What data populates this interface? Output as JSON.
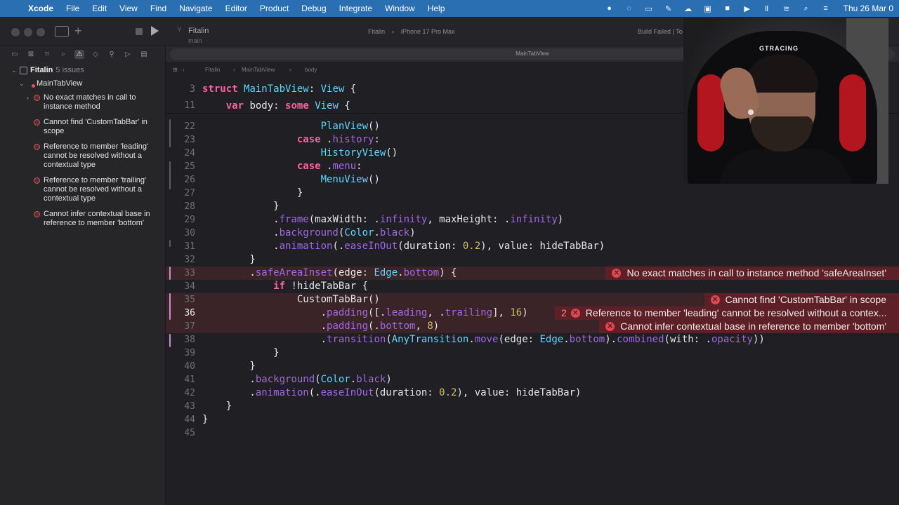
{
  "menubar": {
    "apple_glyph": "",
    "app_name": "Xcode",
    "items": [
      "File",
      "Edit",
      "View",
      "Find",
      "Navigate",
      "Editor",
      "Product",
      "Debug",
      "Integrate",
      "Window",
      "Help"
    ],
    "clock": "Thu 26 Mar 0"
  },
  "toolbar": {
    "project_title": "Fitalin",
    "project_branch": "main",
    "scheme": "Fitalin",
    "destination": "iPhone 17 Pro Max",
    "build_status": "Build Failed | To"
  },
  "tab": {
    "title": "MainTabView"
  },
  "jumpbar": {
    "project": "Fitalin",
    "file": "MainTabView",
    "symbol": "body"
  },
  "navigator": {
    "project": "Fitalin",
    "issue_count": "5 issues",
    "file": "MainTabView",
    "issues": [
      "No exact matches in call to instance method",
      "Cannot find 'CustomTabBar' in scope",
      "Reference to member 'leading' cannot be resolved without a contextual type",
      "Reference to member 'trailing' cannot be resolved without a contextual type",
      "Cannot infer contextual base in reference to member 'bottom'"
    ]
  },
  "editor": {
    "sticky": [
      {
        "ln": "3",
        "code": "struct MainTabView: View {"
      },
      {
        "ln": "11",
        "code": "    var body: some View {"
      }
    ],
    "lines": [
      {
        "ln": "22",
        "code": "                    PlanView()"
      },
      {
        "ln": "23",
        "code": "                case .history:"
      },
      {
        "ln": "24",
        "code": "                    HistoryView()"
      },
      {
        "ln": "25",
        "code": "                case .menu:"
      },
      {
        "ln": "26",
        "code": "                    MenuView()"
      },
      {
        "ln": "27",
        "code": "                }"
      },
      {
        "ln": "28",
        "code": "            }"
      },
      {
        "ln": "29",
        "code": "            .frame(maxWidth: .infinity, maxHeight: .infinity)"
      },
      {
        "ln": "30",
        "code": "            .background(Color.black)"
      },
      {
        "ln": "31",
        "code": "            .animation(.easeInOut(duration: 0.2), value: hideTabBar)"
      },
      {
        "ln": "32",
        "code": "        }"
      },
      {
        "ln": "33",
        "code": "        .safeAreaInset(edge: Edge.bottom) {"
      },
      {
        "ln": "34",
        "code": "            if !hideTabBar {"
      },
      {
        "ln": "35",
        "code": "                CustomTabBar()"
      },
      {
        "ln": "36",
        "code": "                    .padding([.leading, .trailing], 16)"
      },
      {
        "ln": "37",
        "code": "                    .padding(.bottom, 8)"
      },
      {
        "ln": "38",
        "code": "                    .transition(AnyTransition.move(edge: Edge.bottom).combined(with: .opacity))"
      },
      {
        "ln": "39",
        "code": "            }"
      },
      {
        "ln": "40",
        "code": "        }"
      },
      {
        "ln": "41",
        "code": "        .background(Color.black)"
      },
      {
        "ln": "42",
        "code": "        .animation(.easeInOut(duration: 0.2), value: hideTabBar)"
      },
      {
        "ln": "43",
        "code": "    }"
      },
      {
        "ln": "44",
        "code": "}"
      },
      {
        "ln": "45",
        "code": ""
      }
    ],
    "diagnostics": [
      {
        "text": "No exact matches in call to instance method 'safeAreaInset'"
      },
      {
        "text": "Cannot find 'CustomTabBar' in scope"
      },
      {
        "count": "2",
        "text": "Reference to member 'leading' cannot be resolved without a contex..."
      },
      {
        "text": "Cannot infer contextual base in reference to member 'bottom'"
      }
    ]
  },
  "webcam": {
    "chair_brand": "GTRACING"
  }
}
